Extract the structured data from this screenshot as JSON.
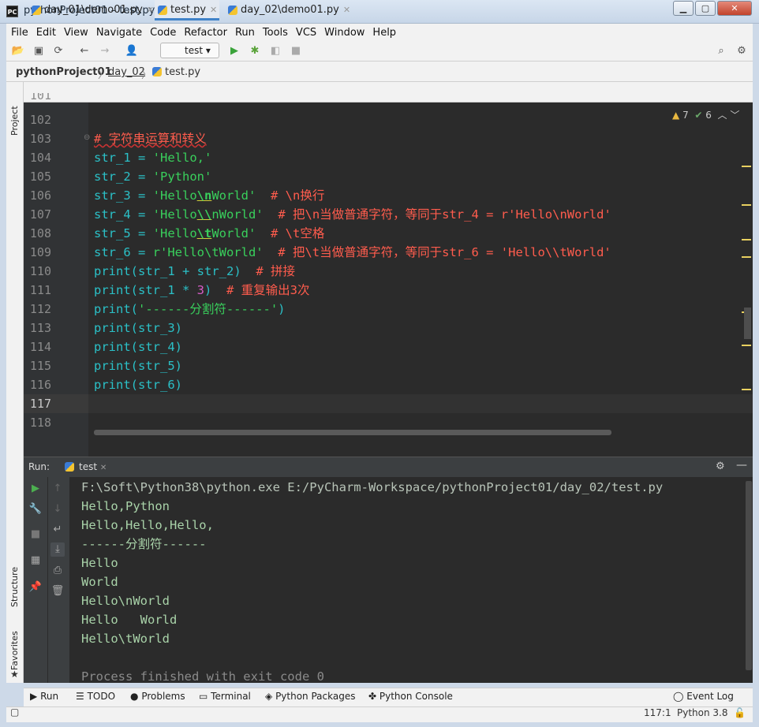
{
  "window": {
    "title": "pythonProject01 – test.py",
    "app_icon": "PC"
  },
  "menu": [
    "File",
    "Edit",
    "View",
    "Navigate",
    "Code",
    "Refactor",
    "Run",
    "Tools",
    "VCS",
    "Window",
    "Help"
  ],
  "toolbar": {
    "run_config": "test"
  },
  "breadcrumb": [
    "pythonProject01",
    "day_02",
    "test.py"
  ],
  "left_stripe": {
    "project": "Project",
    "structure": "Structure",
    "favorites": "Favorites"
  },
  "tabs": [
    {
      "label": "day_01\\demo01.py",
      "active": false
    },
    {
      "label": "test.py",
      "active": true
    },
    {
      "label": "day_02\\demo01.py",
      "active": false
    }
  ],
  "inspections": {
    "warnings": "7",
    "weak_warnings": "6"
  },
  "editor": {
    "lines": [
      "101",
      "102",
      "103",
      "104",
      "105",
      "106",
      "107",
      "108",
      "109",
      "110",
      "111",
      "112",
      "113",
      "114",
      "115",
      "116",
      "117",
      "118"
    ],
    "code": {
      "l103": "# 字符串运算和转义",
      "l104_a": "str_1 = ",
      "l104_b": "'Hello,'",
      "l105_a": "str_2 = ",
      "l105_b": "'Python'",
      "l106_a": "str_3 = ",
      "l106_b": "'Hello",
      "l106_c": "\\n",
      "l106_d": "World'",
      "l106_e": "  # \\n换行",
      "l107_a": "str_4 = ",
      "l107_b": "'Hello",
      "l107_c": "\\\\",
      "l107_d": "nWorld'",
      "l107_e": "  # 把\\n当做普通字符，等同于str_4 = r'Hello\\nWorld'",
      "l108_a": "str_5 = ",
      "l108_b": "'Hello",
      "l108_c": "\\t",
      "l108_d": "World'",
      "l108_e": "  # \\t空格",
      "l109_a": "str_6 = ",
      "l109_b": "r'Hello\\tWorld'",
      "l109_e": "  # 把\\t当做普通字符，等同于str_6 = 'Hello\\\\tWorld'",
      "l110_a": "print",
      "l110_b": "(str_1 + str_2)",
      "l110_c": "  # 拼接",
      "l111_a": "print",
      "l111_b": "(str_1 * ",
      "l111_n": "3",
      "l111_c": ")",
      "l111_d": "  # 重复输出3次",
      "l112_a": "print",
      "l112_b": "(",
      "l112_s": "'------分割符------'",
      "l112_c": ")",
      "l113_a": "print",
      "l113_b": "(str_3)",
      "l114_a": "print",
      "l114_b": "(str_4)",
      "l115_a": "print",
      "l115_b": "(str_5)",
      "l116_a": "print",
      "l116_b": "(str_6)"
    }
  },
  "run": {
    "label": "Run:",
    "tab": "test",
    "output": [
      "F:\\Soft\\Python38\\python.exe E:/PyCharm-Workspace/pythonProject01/day_02/test.py",
      "Hello,Python",
      "Hello,Hello,Hello,",
      "------分割符------",
      "Hello",
      "World",
      "Hello\\nWorld",
      "Hello\tWorld",
      "Hello\\tWorld",
      "",
      "Process finished with exit code 0"
    ]
  },
  "bottom_tools": [
    "Run",
    "TODO",
    "Problems",
    "Terminal",
    "Python Packages",
    "Python Console"
  ],
  "event_log": "Event Log",
  "status": {
    "position": "117:1",
    "interpreter": "Python 3.8"
  }
}
